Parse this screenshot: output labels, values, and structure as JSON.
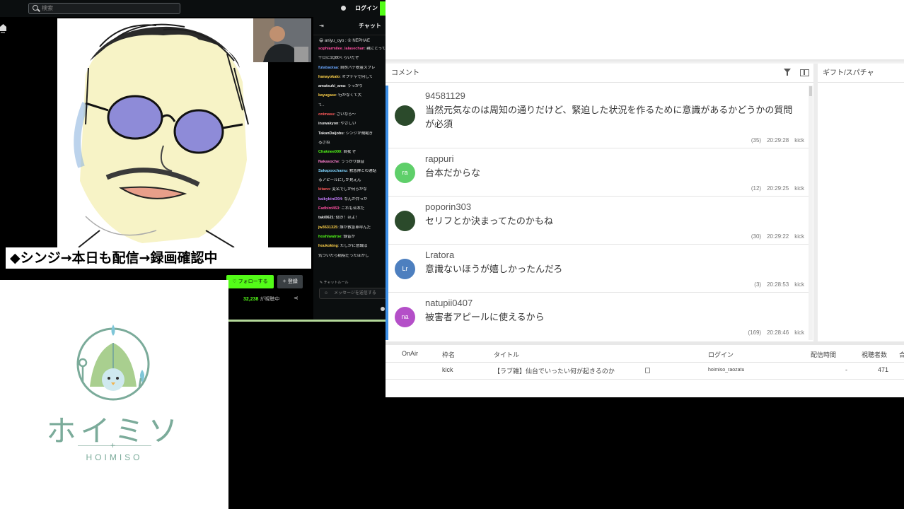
{
  "stream": {
    "search_placeholder": "検索",
    "login_label": "ログイン",
    "caption": "◆シンジ→本日も配信→録画確認中",
    "follow_label": "♡ フォローする",
    "subscribe_label": "✧ 登録",
    "viewer_count": "32,238",
    "viewer_suffix": "が視聴中",
    "share_glyph": "⋖"
  },
  "chat": {
    "collapse_glyph": "⇥",
    "title": "チャット",
    "pinned": "😀 aniyu_oyo : ① NEPHAE",
    "messages": [
      {
        "user": "sophiarmilee_lalasechan",
        "user_color": "#ff4fa0",
        "text": ": 親にとって"
      },
      {
        "user": "",
        "user_color": "#ffffff",
        "text": "千日に1Q80くらいだぞ"
      },
      {
        "user": "futabaotaa",
        "user_color": "#6aa7ff",
        "text": ": 自然バチ税金スプレ"
      },
      {
        "user": "hanayokalo",
        "user_color": "#ffd24a",
        "text": ": オプチャで何して"
      },
      {
        "user": "amatsuki_ama",
        "user_color": "#e8e8e8",
        "text": ": うっかり"
      },
      {
        "user": "kayugase",
        "user_color": "#ffd24a",
        "text": ": 行かなくて大"
      },
      {
        "user": "",
        "user_color": "#ffffff",
        "text": "て.."
      },
      {
        "user": "onimasu",
        "user_color": "#ff5a5a",
        "text": ": さいなら～"
      },
      {
        "user": "inuwakyon",
        "user_color": "#e8e8e8",
        "text": ": やさしい"
      },
      {
        "user": "TakanDaijobu",
        "user_color": "#e8e8e8",
        "text": ": シンジが規範ぎ"
      },
      {
        "user": "",
        "user_color": "#ffffff",
        "text": "るさね"
      },
      {
        "user": "Chaknee000",
        "user_color": "#53fc18",
        "text": ": 自我 ぞ"
      },
      {
        "user": "Nakasoche",
        "user_color": "#ff7fd0",
        "text": ": うっかり録音"
      },
      {
        "user": "Sakapoochamu",
        "user_color": "#7fd4ff",
        "text": ": 救急隊との通話"
      },
      {
        "user": "",
        "user_color": "#ffffff",
        "text": "るアピールにしか見えん"
      },
      {
        "user": "kitano",
        "user_color": "#ff5a5a",
        "text": ": 変名でしか何らかな"
      },
      {
        "user": "kaikybird304",
        "user_color": "#c77dff",
        "text": ": なんか弁っか"
      },
      {
        "user": "Fadbird453",
        "user_color": "#ff4fa0",
        "text": ": これも合本だ"
      },
      {
        "user": "taki0621",
        "user_color": "#e8e8e8",
        "text": ": 個き！ほよ！"
      },
      {
        "user": "jw3631325",
        "user_color": "#ffd24a",
        "text": ": 誰が救急車呼んだ"
      },
      {
        "user": "hoshiwatroe",
        "user_color": "#53fc18",
        "text": ": 録音が"
      },
      {
        "user": "houkoking",
        "user_color": "#ffd24a",
        "text": ": たしかに意識は"
      },
      {
        "user": "",
        "user_color": "#ffffff",
        "text": "気づいたら病院だったほかし"
      }
    ],
    "rules_label": "✎ チャットルール",
    "input_placeholder": "メッセージを送信する"
  },
  "logo": {
    "title": "ホイミソ",
    "subtitle": "HOIMISO",
    "colors": {
      "primary": "#7bab9a",
      "leaf": "#a9cf8f",
      "drop": "#7ec6d8"
    }
  },
  "comment_viewer": {
    "comment_header": "コメント",
    "gift_header": "ギフト/スパチャ",
    "comments": [
      {
        "username": "94581129",
        "text": "当然元気なのは周知の通りだけど、緊迫した状況を作るために意識があるかどうかの質問が必須",
        "count": "(35)",
        "time": "20:29:28",
        "platform": "kick",
        "avatar_text": "",
        "avatar_color": "#2b4a2b"
      },
      {
        "username": "rappuri",
        "text": "台本だからな",
        "count": "(12)",
        "time": "20:29:25",
        "platform": "kick",
        "avatar_text": "ra",
        "avatar_color": "#5fcf6a"
      },
      {
        "username": "poporin303",
        "text": "セリフとか決まってたのかもね",
        "count": "(30)",
        "time": "20:29:22",
        "platform": "kick",
        "avatar_text": "",
        "avatar_color": "#2b4a2b"
      },
      {
        "username": "Lratora",
        "text": "意識ないほうが嬉しかったんだろ",
        "count": "(3)",
        "time": "20:28:53",
        "platform": "kick",
        "avatar_text": "Lr",
        "avatar_color": "#4d7fbf"
      },
      {
        "username": "natupii0407",
        "text": "被害者アピールに使えるから",
        "count": "(169)",
        "time": "20:28:46",
        "platform": "kick",
        "avatar_text": "na",
        "avatar_color": "#b44fc8"
      }
    ],
    "table": {
      "headers": [
        "OnAir",
        "枠名",
        "タイトル",
        "ログイン",
        "配信時間",
        "視聴者数",
        "合"
      ],
      "row": {
        "onair": "",
        "frame": "kick",
        "title": "【ラブ雑】仙台でいったい何が起きるのか",
        "login": "hoimiso_raozatu",
        "duration": "-",
        "viewers": "471"
      }
    }
  },
  "colors": {
    "kick_green": "#53fc18",
    "accent_blue": "#3d8fe6"
  }
}
